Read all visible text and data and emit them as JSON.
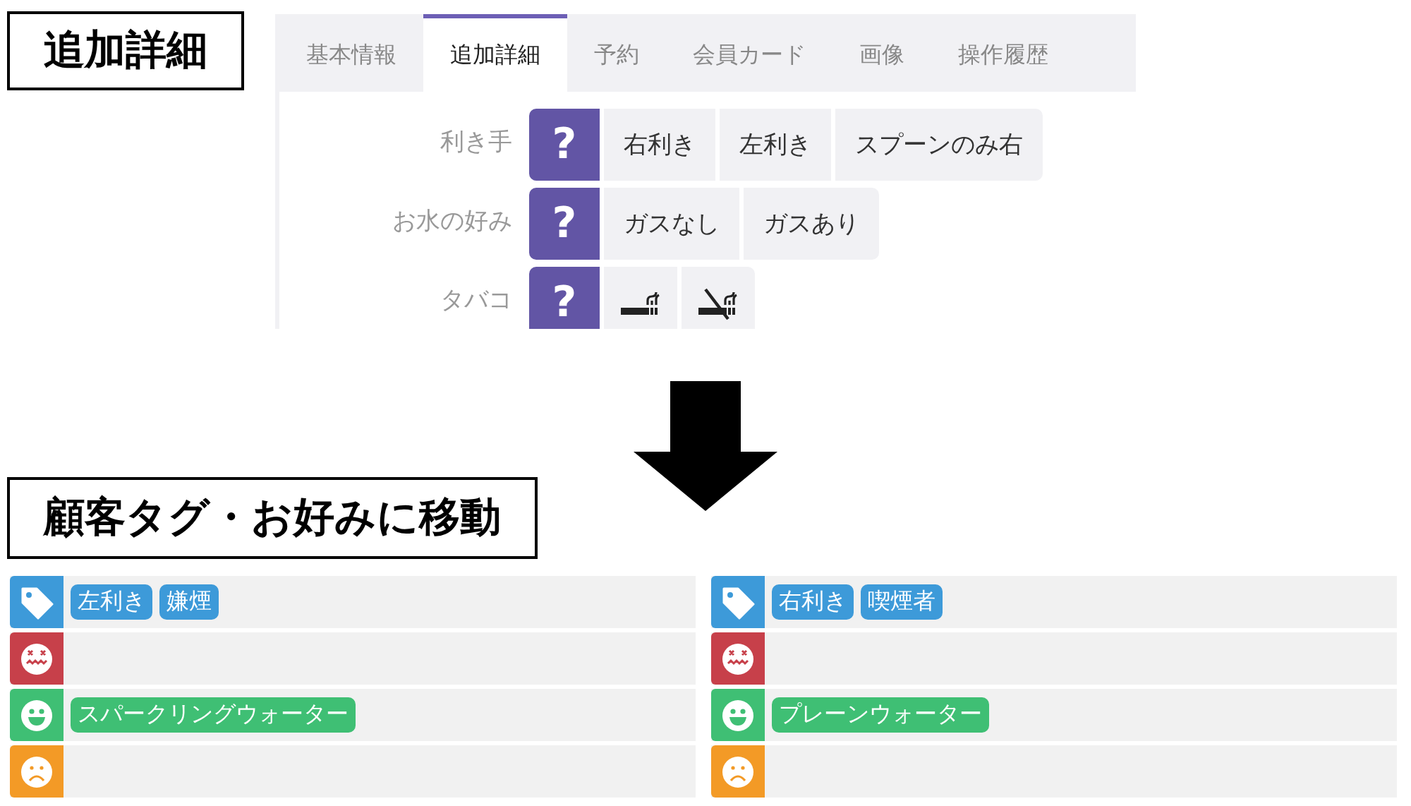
{
  "top_heading": "追加詳細",
  "tabs": [
    {
      "label": "基本情報",
      "selected": false
    },
    {
      "label": "追加詳細",
      "selected": true
    },
    {
      "label": "予約",
      "selected": false
    },
    {
      "label": "会員カード",
      "selected": false
    },
    {
      "label": "画像",
      "selected": false
    },
    {
      "label": "操作履歴",
      "selected": false
    }
  ],
  "fields": [
    {
      "label": "利き手",
      "options": [
        {
          "kind": "unknown",
          "label": "?",
          "selected": true
        },
        {
          "kind": "text",
          "label": "右利き",
          "selected": false
        },
        {
          "kind": "text",
          "label": "左利き",
          "selected": false
        },
        {
          "kind": "text",
          "label": "スプーンのみ右",
          "selected": false
        }
      ]
    },
    {
      "label": "お水の好み",
      "options": [
        {
          "kind": "unknown",
          "label": "?",
          "selected": true
        },
        {
          "kind": "text",
          "label": "ガスなし",
          "selected": false
        },
        {
          "kind": "text",
          "label": "ガスあり",
          "selected": false
        }
      ]
    },
    {
      "label": "タバコ",
      "options": [
        {
          "kind": "unknown",
          "label": "?",
          "selected": true
        },
        {
          "kind": "smoking",
          "selected": false
        },
        {
          "kind": "no-smoking",
          "selected": false
        }
      ]
    }
  ],
  "bottom_heading": "顧客タグ・お好みに移動",
  "customers": [
    {
      "rows": [
        {
          "kind": "tags",
          "color": "#3d9ad9",
          "chips": [
            "左利き",
            "嫌煙"
          ]
        },
        {
          "kind": "dislike",
          "color": "#c7404a"
        },
        {
          "kind": "like",
          "color": "#3fbf74",
          "chips": [
            "スパークリングウォーター"
          ]
        },
        {
          "kind": "unhappy",
          "color": "#f39a26"
        }
      ]
    },
    {
      "rows": [
        {
          "kind": "tags",
          "color": "#3d9ad9",
          "chips": [
            "右利き",
            "喫煙者"
          ]
        },
        {
          "kind": "dislike",
          "color": "#c7404a"
        },
        {
          "kind": "like",
          "color": "#3fbf74",
          "chips": [
            "プレーンウォーター"
          ]
        },
        {
          "kind": "unhappy",
          "color": "#f39a26"
        }
      ]
    }
  ]
}
